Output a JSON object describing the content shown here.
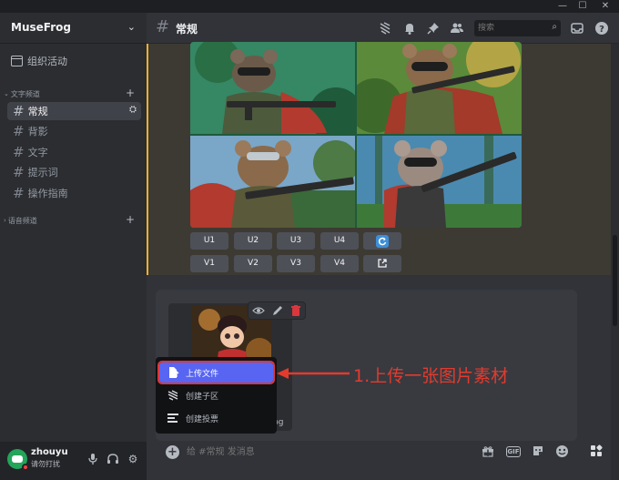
{
  "window": {
    "minimize": "—",
    "maximize": "☐",
    "close": "✕"
  },
  "server": {
    "name": "MuseFrog",
    "chevron": "⌄"
  },
  "sidebar": {
    "events_label": "组织活动",
    "text_category": "文字频道",
    "voice_category": "语音频道",
    "channels": [
      {
        "label": "常规",
        "active": true
      },
      {
        "label": "背影",
        "active": false
      },
      {
        "label": "文字",
        "active": false
      },
      {
        "label": "提示词",
        "active": false
      },
      {
        "label": "操作指南",
        "active": false
      }
    ],
    "hash": "#",
    "plus": "+",
    "collapse_arrow": "⌄",
    "expand_arrow": "›",
    "channel_tools": "⛭"
  },
  "user": {
    "name": "zhouyu",
    "status": "请勿打扰",
    "mic_icon": "mic-icon",
    "headset_icon": "headset-icon",
    "settings_icon": "gear-icon"
  },
  "header": {
    "hash": "#",
    "channel": "常规",
    "search_placeholder": "搜索",
    "icons": [
      "threads-icon",
      "bell-icon",
      "pin-icon",
      "members-icon",
      "search-icon",
      "inbox-icon",
      "help-icon"
    ]
  },
  "image_grid": {
    "tiles": [
      "rat-soldier-1",
      "rat-soldier-2",
      "rat-soldier-3",
      "rat-soldier-4"
    ]
  },
  "buttons": {
    "row1": [
      "U1",
      "U2",
      "U3",
      "U4"
    ],
    "row2": [
      "V1",
      "V2",
      "V3",
      "V4"
    ],
    "reroll_icon": "refresh-icon",
    "web_icon": "external-link-icon"
  },
  "attachment": {
    "filename_fragment": "pg"
  },
  "menu": {
    "items": [
      {
        "label": "上传文件",
        "icon": "upload-file-icon",
        "selected": true
      },
      {
        "label": "创建子区",
        "icon": "thread-icon",
        "selected": false
      },
      {
        "label": "创建投票",
        "icon": "poll-icon",
        "selected": false
      }
    ]
  },
  "composer": {
    "placeholder": "给 #常规 发消息",
    "plus": "+",
    "icons": [
      "gift-icon",
      "gif-icon",
      "sticker-icon",
      "emoji-icon",
      "apps-icon"
    ],
    "gif_label": "GIF"
  },
  "annotation": {
    "text": "1.上传一张图片素材",
    "color": "#e23b2e"
  },
  "colors": {
    "accent": "#5865f2",
    "highlight": "#f0b232",
    "danger": "#da373c",
    "online_dnd": "#f23f43"
  }
}
